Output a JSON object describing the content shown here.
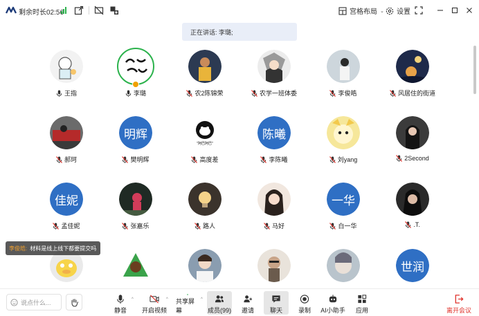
{
  "topbar": {
    "timer_label": "剩余时长02:56",
    "layout_label": "宫格布局",
    "settings_label": "设置"
  },
  "speaking_banner": "正在讲话: 李璐;",
  "participants": [
    {
      "name": "王指",
      "avatar": "img",
      "mic": "on"
    },
    {
      "name": "李璐",
      "avatar": "img",
      "mic": "on",
      "active": true
    },
    {
      "name": "农2陈锦荣",
      "avatar": "img",
      "mic": "off"
    },
    {
      "name": "农学一班体委",
      "avatar": "img",
      "mic": "off"
    },
    {
      "name": "李俊皓",
      "avatar": "img",
      "mic": "off"
    },
    {
      "name": "风居住的街道",
      "avatar": "img",
      "mic": "off"
    },
    {
      "name": "郝珂",
      "avatar": "img",
      "mic": "off"
    },
    {
      "name": "樊明辉",
      "avatar": "text",
      "avatar_text": "明辉",
      "mic": "off"
    },
    {
      "name": "高度差",
      "avatar": "img",
      "avatar_caption": "\"阿巴阿巴\"",
      "mic": "off"
    },
    {
      "name": "李陈曦",
      "avatar": "text",
      "avatar_text": "陈曦",
      "mic": "off"
    },
    {
      "name": "刘yang",
      "avatar": "img",
      "mic": "off"
    },
    {
      "name": "2Second",
      "avatar": "img",
      "mic": "off"
    },
    {
      "name": "孟佳妮",
      "avatar": "text",
      "avatar_text": "佳妮",
      "mic": "off"
    },
    {
      "name": "张嘉乐",
      "avatar": "img",
      "mic": "off"
    },
    {
      "name": "路人",
      "avatar": "img",
      "mic": "off"
    },
    {
      "name": "马好",
      "avatar": "img",
      "mic": "off"
    },
    {
      "name": "白一华",
      "avatar": "text",
      "avatar_text": "一华",
      "mic": "off"
    },
    {
      "name": ".T.",
      "avatar": "img",
      "mic": "off"
    },
    {
      "name": "",
      "avatar": "img",
      "mic": ""
    },
    {
      "name": "",
      "avatar": "img",
      "mic": ""
    },
    {
      "name": "",
      "avatar": "img",
      "mic": ""
    },
    {
      "name": "",
      "avatar": "img",
      "mic": ""
    },
    {
      "name": "",
      "avatar": "img",
      "mic": ""
    },
    {
      "name": "",
      "avatar": "text",
      "avatar_text": "世润",
      "mic": ""
    }
  ],
  "toast": {
    "user": "李俊皓:",
    "message": "材料是线上线下都要提交吗"
  },
  "bottombar": {
    "chat_placeholder": "说点什么...",
    "mute_label": "静音",
    "video_label": "开启视频",
    "share_label": "共享屏幕",
    "members_label": "成员(99)",
    "invite_label": "邀请",
    "chat_label": "聊天",
    "record_label": "录制",
    "ai_label": "AI小助手",
    "apps_label": "应用",
    "leave_label": "离开会议"
  },
  "colors": {
    "accent_blue": "#2f6fc4",
    "active_green": "#2bb24c",
    "leave_red": "#e0322b",
    "mic_off_red": "#e0322b"
  }
}
